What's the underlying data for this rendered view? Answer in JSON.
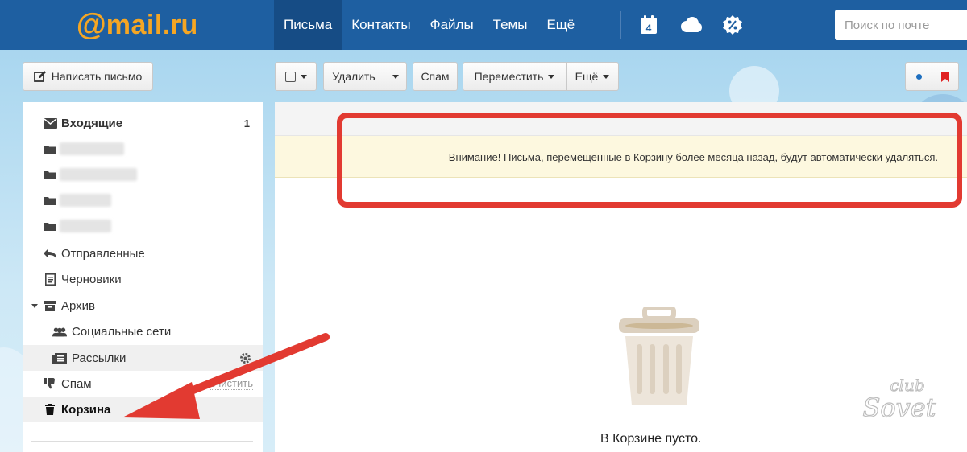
{
  "logo": {
    "at": "@",
    "name": "mail",
    "ru": ".ru"
  },
  "nav": {
    "items": [
      {
        "label": "Письма"
      },
      {
        "label": "Контакты"
      },
      {
        "label": "Файлы"
      },
      {
        "label": "Темы"
      },
      {
        "label": "Ещё"
      }
    ],
    "icons": [
      "calendar-icon",
      "cloud-icon",
      "discount-icon"
    ],
    "calendar_day": "4"
  },
  "search": {
    "placeholder": "Поиск по почте"
  },
  "compose": {
    "label": "Написать письмо"
  },
  "toolbar": {
    "delete_label": "Удалить",
    "spam_label": "Спам",
    "move_label": "Переместить",
    "more_label": "Ещё"
  },
  "sidebar": {
    "inbox": {
      "label": "Входящие",
      "count": "1"
    },
    "sent": {
      "label": "Отправленные"
    },
    "drafts": {
      "label": "Черновики"
    },
    "archive": {
      "label": "Архив"
    },
    "social": {
      "label": "Социальные сети"
    },
    "newsletters": {
      "label": "Рассылки"
    },
    "spam": {
      "label": "Спам",
      "action": "очистить"
    },
    "trash": {
      "label": "Корзина"
    }
  },
  "notice": {
    "text": "Внимание! Письма, перемещенные в Корзину более месяца назад, будут автоматически удаляться."
  },
  "empty_state": {
    "text": "В Корзине пусто."
  },
  "watermark": "Sovet club",
  "colors": {
    "topbar": "#1e5fa1",
    "brand": "#f5a623",
    "annotation": "#e23a31",
    "notice_bg": "#fdf8df"
  }
}
